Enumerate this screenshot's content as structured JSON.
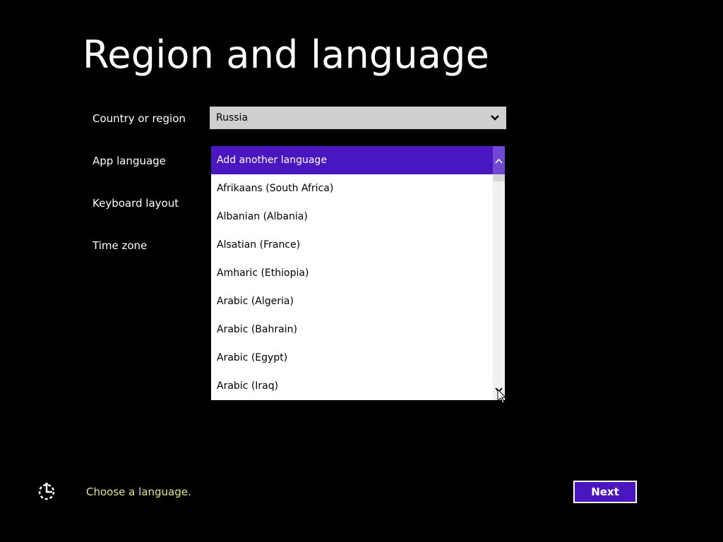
{
  "page": {
    "title": "Region and language"
  },
  "fields": {
    "country_label": "Country or region",
    "app_language_label": "App language",
    "keyboard_layout_label": "Keyboard layout",
    "time_zone_label": "Time zone"
  },
  "country_select": {
    "value": "Russia",
    "icon": "chevron-down-icon"
  },
  "language_dropdown": {
    "selected_index": 0,
    "items": [
      "Add another language",
      "Afrikaans (South Africa)",
      "Albanian (Albania)",
      "Alsatian (France)",
      "Amharic (Ethiopia)",
      "Arabic (Algeria)",
      "Arabic (Bahrain)",
      "Arabic (Egypt)",
      "Arabic (Iraq)"
    ],
    "scrollbar": {
      "up_icon": "chevron-up-icon",
      "down_icon": "chevron-down-icon"
    }
  },
  "footer": {
    "accessibility_icon": "ease-of-access-icon",
    "status_text": "Choose a language.",
    "next_label": "Next"
  },
  "colors": {
    "background": "#000000",
    "accent": "#4a16c0",
    "status_text": "#e8e48a",
    "select_background": "#cfcfcf"
  }
}
